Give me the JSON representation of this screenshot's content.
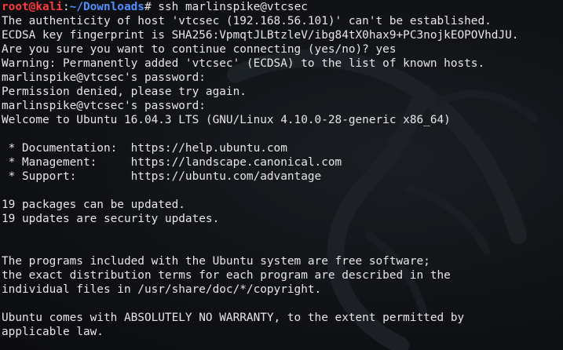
{
  "prompt": {
    "user_host": "root@kali",
    "separator": ":",
    "path": "~/Downloads",
    "symbol": "# ",
    "command": "ssh marlinspike@vtcsec"
  },
  "output": [
    "The authenticity of host 'vtcsec (192.168.56.101)' can't be established.",
    "ECDSA key fingerprint is SHA256:VpmqtJLBtzleV/ibg84tX0hax9+PC3nojkEOPOVhdJU.",
    "Are you sure you want to continue connecting (yes/no)? yes",
    "Warning: Permanently added 'vtcsec' (ECDSA) to the list of known hosts.",
    "marlinspike@vtcsec's password:",
    "Permission denied, please try again.",
    "marlinspike@vtcsec's password:",
    "Welcome to Ubuntu 16.04.3 LTS (GNU/Linux 4.10.0-28-generic x86_64)",
    "",
    " * Documentation:  https://help.ubuntu.com",
    " * Management:     https://landscape.canonical.com",
    " * Support:        https://ubuntu.com/advantage",
    "",
    "19 packages can be updated.",
    "19 updates are security updates.",
    "",
    "",
    "The programs included with the Ubuntu system are free software;",
    "the exact distribution terms for each program are described in the",
    "individual files in /usr/share/doc/*/copyright.",
    "",
    "Ubuntu comes with ABSOLUTELY NO WARRANTY, to the extent permitted by",
    "applicable law."
  ],
  "colors": {
    "user_host": "#ff3b3b",
    "path": "#4f8fff",
    "text": "#e6e6e6",
    "background": "#101216"
  }
}
